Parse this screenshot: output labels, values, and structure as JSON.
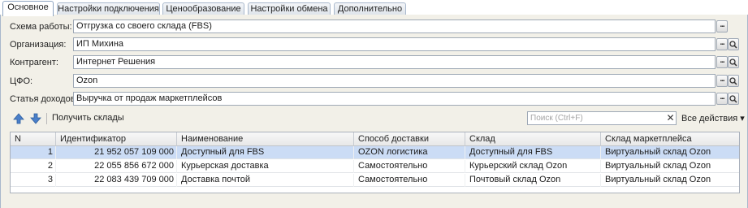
{
  "tabs": [
    {
      "label": "Основное",
      "active": true
    },
    {
      "label": "Настройки подключения",
      "active": false
    },
    {
      "label": "Ценообразование",
      "active": false
    },
    {
      "label": "Настройки обмена",
      "active": false
    },
    {
      "label": "Дополнительно",
      "active": false
    }
  ],
  "form": {
    "scheme": {
      "label": "Схема работы:",
      "value": "Отгрузка со своего склада (FBS)"
    },
    "organization": {
      "label": "Организация:",
      "value": "ИП Михина"
    },
    "counterparty": {
      "label": "Контрагент:",
      "value": "Интернет Решения"
    },
    "cfo": {
      "label": "ЦФО:",
      "value": "Ozon"
    },
    "income_item": {
      "label": "Статья доходов:",
      "value": "Выручка от продаж маркетплейсов"
    }
  },
  "toolbar": {
    "get_warehouses_label": "Получить склады",
    "search_placeholder": "Поиск (Ctrl+F)",
    "clear_symbol": "✕",
    "all_actions_label": "Все действия",
    "all_actions_arrow": "▾"
  },
  "buttons": {
    "dots": "...",
    "search_glyph": "⚲"
  },
  "table": {
    "columns": [
      "N",
      "Идентификатор",
      "Наименование",
      "Способ доставки",
      "Склад",
      "Склад маркетплейса"
    ],
    "rows": [
      {
        "n": "1",
        "id": "21 952 057 109 000",
        "name": "Доступный для FBS",
        "delivery": "OZON логистика",
        "warehouse": "Доступный для FBS",
        "mp_warehouse": "Виртуальный склад  Ozon"
      },
      {
        "n": "2",
        "id": "22 055 856 672 000",
        "name": "Курьерская доставка",
        "delivery": "Самостоятельно",
        "warehouse": "Курьерский склад Ozon",
        "mp_warehouse": "Виртуальный склад  Ozon"
      },
      {
        "n": "3",
        "id": "22 083 439 709 000",
        "name": "Доставка почтой",
        "delivery": "Самостоятельно",
        "warehouse": "Почтовый склад Ozon",
        "mp_warehouse": "Виртуальный склад  Ozon"
      }
    ]
  },
  "colors": {
    "selected_row": "#cbdcf5",
    "frame_bg": "#f2f0e8",
    "arrow_blue": "#4a7fc9"
  }
}
